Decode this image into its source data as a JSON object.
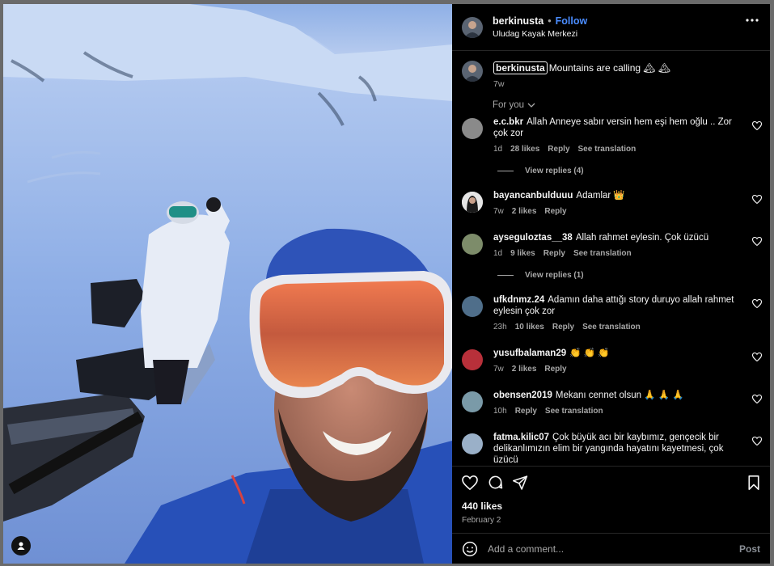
{
  "post": {
    "username": "berkinusta",
    "follow_label": "Follow",
    "separator": "•",
    "location": "Uludag Kayak Merkezi",
    "caption": {
      "username": "berkinusta",
      "text": "Mountains are calling 🏔 🏔",
      "time": "7w"
    },
    "sort_label": "For you",
    "likes": "440 likes",
    "date": "February 2",
    "add_comment_placeholder": "Add a comment...",
    "post_label": "Post"
  },
  "comments": [
    {
      "user": "e.c.bkr",
      "text": "Allah Anneye sabır versin hem eşi hem oğlu .. Zor çok zor",
      "time": "1d",
      "likes": "28 likes",
      "reply": "Reply",
      "translation": "See translation",
      "view_replies": "View replies (4)",
      "avatar_color": "#8a8a8a"
    },
    {
      "user": "bayancanbulduuu",
      "text": "Adamlar 👑",
      "time": "7w",
      "likes": "2 likes",
      "reply": "Reply",
      "avatar_color": "#d9d9d9"
    },
    {
      "user": "ayseguloztas__38",
      "text": "Allah rahmet eylesin. Çok üzücü",
      "time": "1d",
      "likes": "9 likes",
      "reply": "Reply",
      "translation": "See translation",
      "view_replies": "View replies (1)",
      "avatar_color": "#7d8c6a"
    },
    {
      "user": "ufkdnmz.24",
      "text": "Adamın daha attığı story duruyo allah rahmet eylesin çok zor",
      "time": "23h",
      "likes": "10 likes",
      "reply": "Reply",
      "translation": "See translation",
      "avatar_color": "#4f6e8a"
    },
    {
      "user": "yusufbalaman29",
      "text": "👏 👏 👏",
      "time": "7w",
      "likes": "2 likes",
      "reply": "Reply",
      "avatar_color": "#b8303a"
    },
    {
      "user": "obensen2019",
      "text": "Mekanı cennet olsun 🙏 🙏 🙏",
      "time": "10h",
      "reply": "Reply",
      "translation": "See translation",
      "avatar_color": "#7a9aa8"
    },
    {
      "user": "fatma.kilic07",
      "text": "Çok büyük acı bir kaybımız, gençecik bir delikanlımızın elim bir yangında hayatını kayetmesi, çok üzücü",
      "avatar_color": "#9ab0c8"
    }
  ],
  "colors": {
    "follow": "#4a8cff",
    "background": "#000000",
    "secondary_text": "#a8a8a8"
  },
  "icons": [
    "more-icon",
    "heart-icon",
    "comment-icon",
    "share-icon",
    "bookmark-icon",
    "emoji-icon",
    "user-tag-icon",
    "chevron-down-icon"
  ]
}
